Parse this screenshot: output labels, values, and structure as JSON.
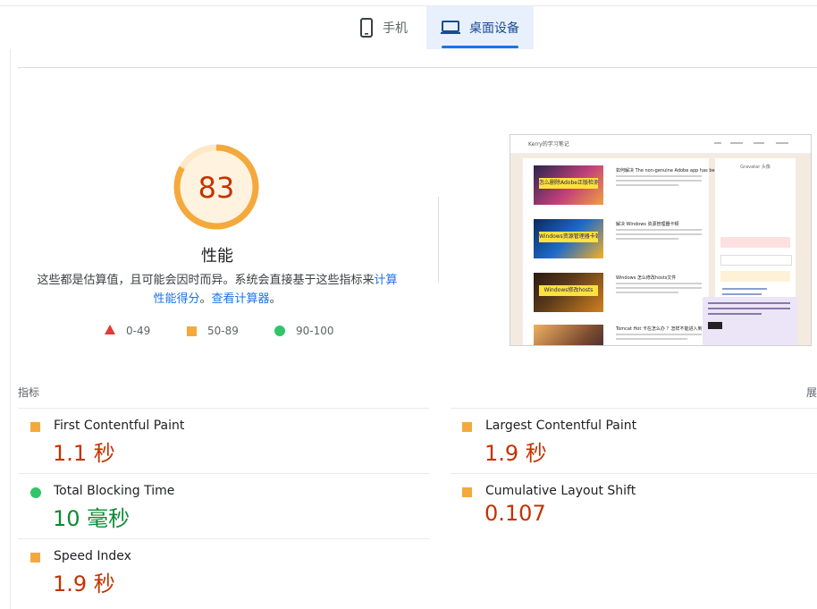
{
  "tabs": {
    "mobile": {
      "label": "手机",
      "icon": "phone-icon"
    },
    "desktop": {
      "label": "桌面设备",
      "icon": "laptop-icon",
      "selected": true
    }
  },
  "performance": {
    "score": "83",
    "score_fraction": 0.83,
    "title": "性能",
    "description_prefix": "这些都是估算值，且可能会因时而异。系统会直接基于这些指标来",
    "calc_link": "计算性能得分",
    "description_mid": "。",
    "calculator_link": "查看计算器",
    "description_suffix": "。"
  },
  "legend": [
    {
      "range": "0-49",
      "icon": "triangle-icon",
      "color": "#e53935"
    },
    {
      "range": "50-89",
      "icon": "square-icon",
      "color": "#f4a93c"
    },
    {
      "range": "90-100",
      "icon": "circle-icon",
      "color": "#33c46b"
    }
  ],
  "screenshot": {
    "brand": "Kerry的学习笔记",
    "posts": [
      {
        "caption": "怎么删除Adobe正版检测服务",
        "title": "如何解决 The non-genuine Adobe app has been disabled"
      },
      {
        "caption": "Windows资源管理器卡顿",
        "title": "解决 Windows 资源管理器卡顿"
      },
      {
        "caption": "Windows修改hosts",
        "title": "Windows 怎么修改hosts文件"
      },
      {
        "caption": "",
        "title": "Tomcat Hot 卡在怎么办 ？怎样不能进入到..."
      }
    ],
    "sidebar_title": "Gravatar 头像"
  },
  "metrics": {
    "section_label": "指标",
    "expand_label": "展",
    "items": [
      {
        "name": "First Contentful Paint",
        "value": "1.1 秒",
        "status": "average"
      },
      {
        "name": "Largest Contentful Paint",
        "value": "1.9 秒",
        "status": "average"
      },
      {
        "name": "Total Blocking Time",
        "value": "10 毫秒",
        "status": "pass"
      },
      {
        "name": "Cumulative Layout Shift",
        "value": "0.107",
        "status": "average"
      },
      {
        "name": "Speed Index",
        "value": "1.9 秒",
        "status": "average"
      }
    ]
  },
  "colors": {
    "average": "#f4a93c",
    "average_text": "#c33300",
    "pass": "#33c46b",
    "pass_text": "#0d8a35",
    "fail": "#e53935",
    "accent": "#1a73e8"
  }
}
